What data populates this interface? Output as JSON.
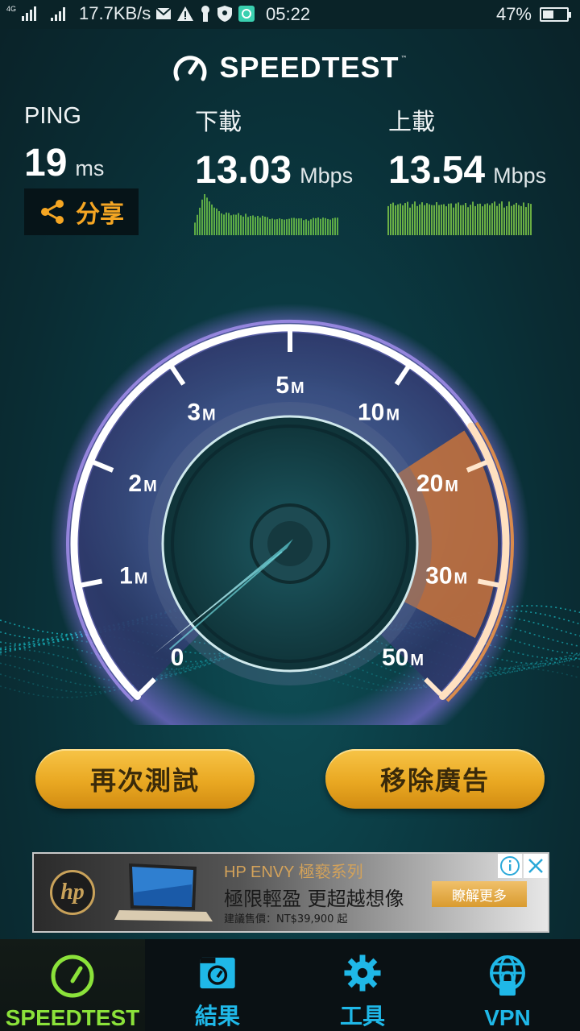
{
  "status_bar": {
    "network_tag": "4G",
    "data_rate": "17.7KB/s",
    "time": "05:22",
    "battery": "47%",
    "battery_level": 0.47
  },
  "header": {
    "title": "SPEEDTEST",
    "tm": "™",
    "icon": "speedometer-icon"
  },
  "ping": {
    "label": "PING",
    "value": "19",
    "unit": "ms"
  },
  "download": {
    "label": "下載",
    "value": "13.03",
    "unit": "Mbps"
  },
  "upload": {
    "label": "上載",
    "value": "13.54",
    "unit": "Mbps"
  },
  "share": {
    "label": "分享",
    "icon": "share-icon"
  },
  "gauge": {
    "ticks": [
      {
        "num": "0",
        "suffix": ""
      },
      {
        "num": "1",
        "suffix": "M"
      },
      {
        "num": "2",
        "suffix": "M"
      },
      {
        "num": "3",
        "suffix": "M"
      },
      {
        "num": "5",
        "suffix": "M"
      },
      {
        "num": "10",
        "suffix": "M"
      },
      {
        "num": "20",
        "suffix": "M"
      },
      {
        "num": "30",
        "suffix": "M"
      },
      {
        "num": "50",
        "suffix": "M"
      }
    ],
    "needle_value": "0"
  },
  "buttons": {
    "retest": "再次測試",
    "remove_ads": "移除廣告"
  },
  "ad": {
    "brand": "HP ENVY 極褻系列",
    "headline": "極限輕盈 更超越想像",
    "price": "建議售價：NT$39,900 起",
    "cta": "瞭解更多",
    "logo": "hp"
  },
  "nav": [
    {
      "label": "SPEEDTEST",
      "icon": "speedometer-icon",
      "color": "#8be23a",
      "active": true
    },
    {
      "label": "結果",
      "icon": "results-icon",
      "color": "#1fb8e8",
      "active": false
    },
    {
      "label": "工具",
      "icon": "gear-icon",
      "color": "#1fb8e8",
      "active": false
    },
    {
      "label": "VPN",
      "icon": "globe-lock-icon",
      "color": "#1fb8e8",
      "active": false
    }
  ],
  "colors": {
    "accent_orange": "#f5a623",
    "nav_active": "#8be23a",
    "nav_inactive": "#1fb8e8",
    "button_gold": "#e9a822"
  }
}
